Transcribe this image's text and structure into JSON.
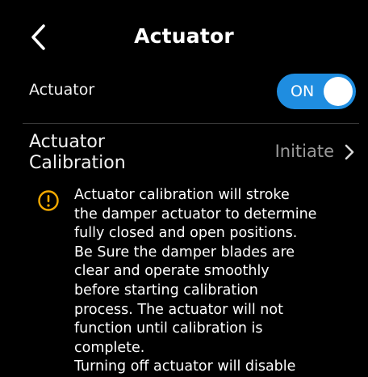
{
  "header": {
    "title": "Actuator",
    "back_icon": "chevron-left-icon"
  },
  "actuator_row": {
    "label": "Actuator",
    "toggle_state": "ON",
    "toggle_color": "#1f8de0"
  },
  "calibration_row": {
    "label": "Actuator\nCalibration",
    "action": "Initiate",
    "action_icon": "chevron-right-icon"
  },
  "warning": {
    "icon": "warning-circle-icon",
    "icon_color": "#f2a900",
    "text": "Actuator calibration will stroke\nthe damper actuator to determine\nfully closed and open positions.\nBe Sure the damper blades are\nclear and operate smoothly\nbefore starting calibration\nprocess. The actuator will not\nfunction until calibration is\ncomplete.\nTurning off actuator will disable"
  }
}
